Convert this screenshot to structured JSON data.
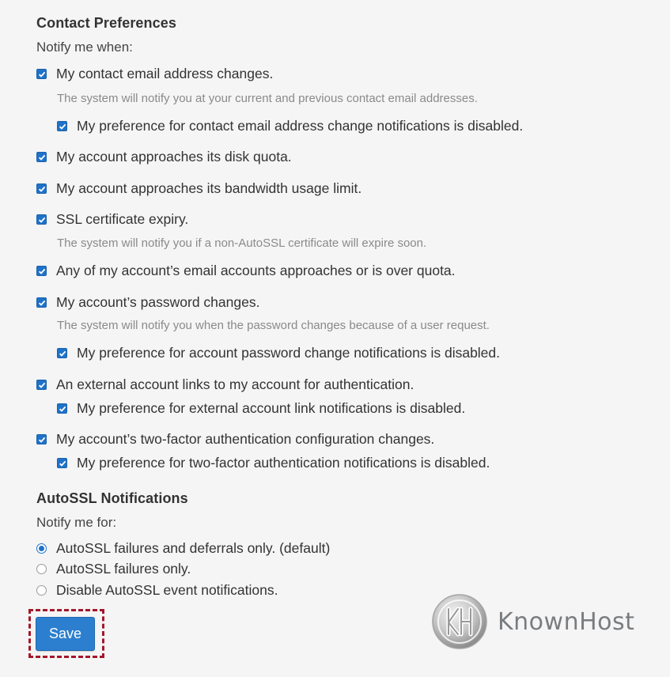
{
  "contact": {
    "heading": "Contact Preferences",
    "subheading": "Notify me when:",
    "items": [
      {
        "label": "My contact email address changes.",
        "checked": true,
        "help": "The system will notify you at your current and previous contact email addresses.",
        "sub": "My preference for contact email address change notifications is disabled."
      },
      {
        "label": "My account approaches its disk quota.",
        "checked": true
      },
      {
        "label": "My account approaches its bandwidth usage limit.",
        "checked": true
      },
      {
        "label": "SSL certificate expiry.",
        "checked": true,
        "help": "The system will notify you if a non-AutoSSL certificate will expire soon."
      },
      {
        "label": "Any of my account’s email accounts approaches or is over quota.",
        "checked": true
      },
      {
        "label": "My account’s password changes.",
        "checked": true,
        "help": "The system will notify you when the password changes because of a user request.",
        "sub": "My preference for account password change notifications is disabled."
      },
      {
        "label": "An external account links to my account for authentication.",
        "checked": true,
        "sub": "My preference for external account link notifications is disabled."
      },
      {
        "label": "My account’s two-factor authentication configuration changes.",
        "checked": true,
        "sub": "My preference for two-factor authentication notifications is disabled."
      }
    ]
  },
  "autossl": {
    "heading": "AutoSSL Notifications",
    "subheading": "Notify me for:",
    "options": [
      {
        "label": "AutoSSL failures and deferrals only. (default)",
        "selected": true
      },
      {
        "label": "AutoSSL failures only.",
        "selected": false
      },
      {
        "label": "Disable AutoSSL event notifications.",
        "selected": false
      }
    ]
  },
  "save_label": "Save",
  "brand": {
    "logo_text": "KnownHost",
    "logo_letters": "KH"
  },
  "colors": {
    "accent": "#1f72c9",
    "save_button": "#2c7fcf",
    "highlight_border": "#a4162a",
    "help_text": "#8a8a8a"
  }
}
